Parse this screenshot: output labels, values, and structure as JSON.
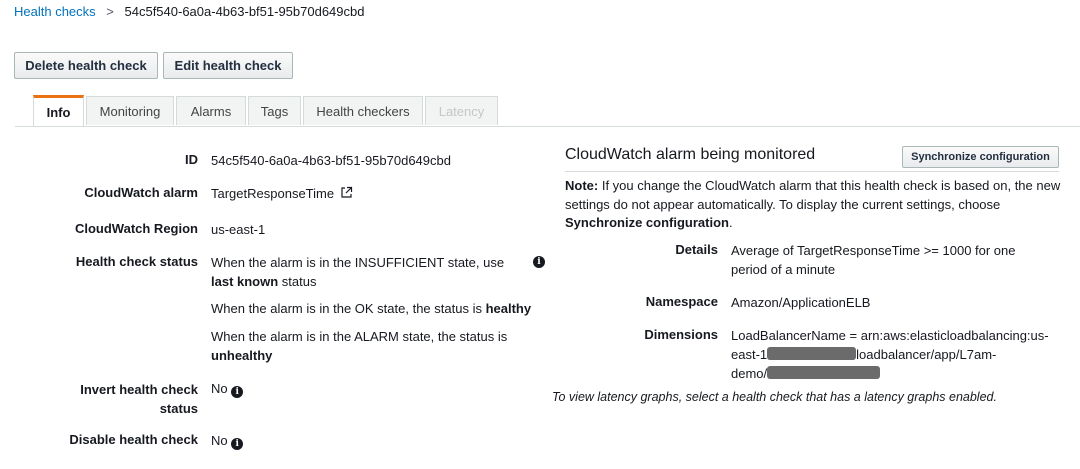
{
  "breadcrumb": {
    "parent": "Health checks",
    "separator": ">",
    "current": "54c5f540-6a0a-4b63-bf51-95b70d649cbd"
  },
  "toolbar": {
    "delete_label": "Delete health check",
    "edit_label": "Edit health check"
  },
  "tabs": [
    {
      "label": "Info",
      "state": "active"
    },
    {
      "label": "Monitoring",
      "state": "normal"
    },
    {
      "label": "Alarms",
      "state": "normal"
    },
    {
      "label": "Tags",
      "state": "normal"
    },
    {
      "label": "Health checkers",
      "state": "normal"
    },
    {
      "label": "Latency",
      "state": "disabled"
    }
  ],
  "details": {
    "id_label": "ID",
    "id_value": "54c5f540-6a0a-4b63-bf51-95b70d649cbd",
    "alarm_label": "CloudWatch alarm",
    "alarm_value": "TargetResponseTime",
    "region_label": "CloudWatch Region",
    "region_value": "us-east-1",
    "status_label": "Health check status",
    "status_insufficient_pre": "When the alarm is in the INSUFFICIENT state, use ",
    "status_insufficient_bold": "last known",
    "status_insufficient_post": " status",
    "status_ok_pre": "When the alarm is in the OK state, the status is ",
    "status_ok_bold": "healthy",
    "status_alarm_pre": "When the alarm is in the ALARM state, the status is ",
    "status_alarm_bold": "unhealthy",
    "invert_label_1": "Invert health check",
    "invert_label_2": "status",
    "invert_value": "No",
    "disable_label": "Disable health check",
    "disable_value": "No"
  },
  "monitor_panel": {
    "title": "CloudWatch alarm being monitored",
    "sync_label": "Synchronize configuration",
    "note_bold": "Note:",
    "note_text": " If you change the CloudWatch alarm that this health check is based on, the new settings do not appear automatically. To display the current settings, choose ",
    "note_link_bold": "Synchronize configuration",
    "note_end": ".",
    "details_label": "Details",
    "details_value": "Average of TargetResponseTime >= 1000 for one period of a minute",
    "namespace_label": "Namespace",
    "namespace_value": "Amazon/ApplicationELB",
    "dimensions_label": "Dimensions",
    "dim_line1": "LoadBalancerName = arn:aws:elasticloadbalancing:us-",
    "dim_line2_pre": "east-1",
    "dim_line2_post": "loadbalancer/app/L7am-",
    "dim_line3_pre": "demo/"
  },
  "latency_note": "To view latency graphs, select a health check that has a latency graphs enabled.",
  "icons": {
    "external_link": "external-link-icon",
    "info": "info-icon"
  },
  "colors": {
    "link": "#0073bb",
    "tab_accent": "#ec7211",
    "redaction": "#6b6b6b"
  }
}
